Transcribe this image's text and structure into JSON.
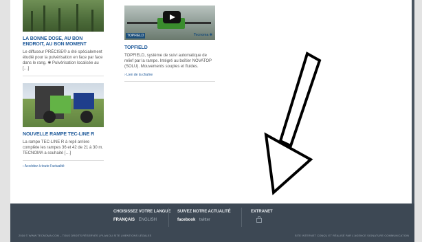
{
  "articles": [
    {
      "title": "LA BONNE DOSE, AU BON ENDROIT, AU BON MOMENT",
      "text": "Le diffuseur PRÉCISE® a été spécialement étudié pour la pulvérisation en face par face dans le rang. ✱ Pulvérisation localisée au […]"
    },
    {
      "title": "TOPFIELD",
      "text": "TOPFIELD, système de suivi automatique de relief par la rampe. Intégré au boîtier NOVATOP (SOLU). Mouvements souples et fluides.",
      "link": "› Lien de la chaîne",
      "image_brand_left": "TOPFIELD",
      "image_brand_right": "Tecnoma ✱"
    },
    {
      "title": "NOUVELLE RAMPE TEC-LINE R",
      "text": "La rampe TEC-LINE R à repli arrière complète les rampes 36 et 42 de 21 à 30 m. TECNOMA a souhaité […]"
    }
  ],
  "all_news_link": "› Accédez à toute l'actualité",
  "footer": {
    "language": {
      "heading": "CHOISISSEZ VOTRE LANGUE",
      "options": [
        "FRANÇAIS",
        "ENGLISH"
      ]
    },
    "follow": {
      "heading": "SUIVEZ NOTRE ACTUALITÉ",
      "options": [
        "facebook",
        "twitter"
      ]
    },
    "extranet": {
      "heading": "EXTRANET",
      "icon": "lock-icon"
    },
    "copyright": "2016 © WWW.TECNOMA.COM – TOUS DROITS RÉSERVÉS | PLAN DU SITE | MENTIONS LÉGALES",
    "credit": "SITE INTERNET CONÇU ET RÉALISÉ PAR L'AGENCE SIGNATURE COMMUNICATION"
  },
  "annotation": {
    "icon": "down-left-arrow-icon",
    "color": "#000000"
  }
}
